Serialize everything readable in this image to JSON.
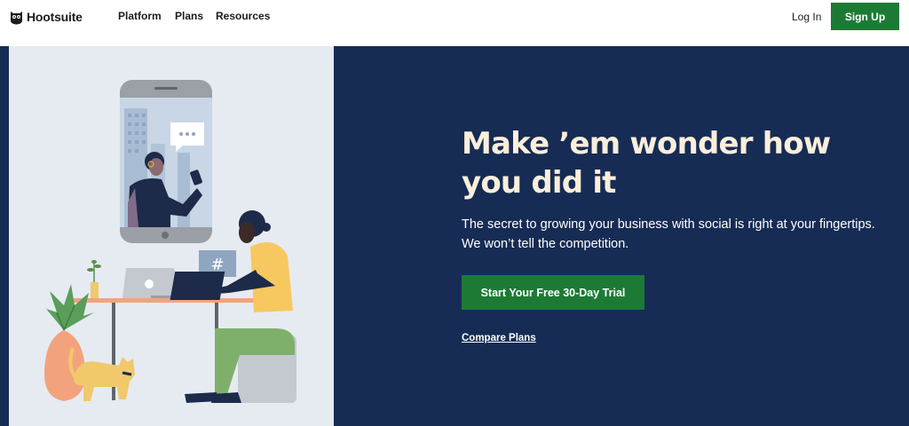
{
  "nav": {
    "brand": "Hootsuite",
    "links": [
      "Platform",
      "Plans",
      "Resources"
    ],
    "login": "Log In",
    "signup": "Sign Up"
  },
  "hero": {
    "headline": "Make ’em wonder how you did it",
    "subtext": "The secret to growing your business with social is right at your fingertips. We won’t tell the competition.",
    "cta": "Start Your Free 30-Day Trial",
    "secondary_link": "Compare Plans",
    "illustration_hashtag": "#"
  },
  "colors": {
    "navy": "#162c54",
    "green": "#1d7a35",
    "cream": "#fbeedb",
    "panel": "#e6ebf2"
  }
}
